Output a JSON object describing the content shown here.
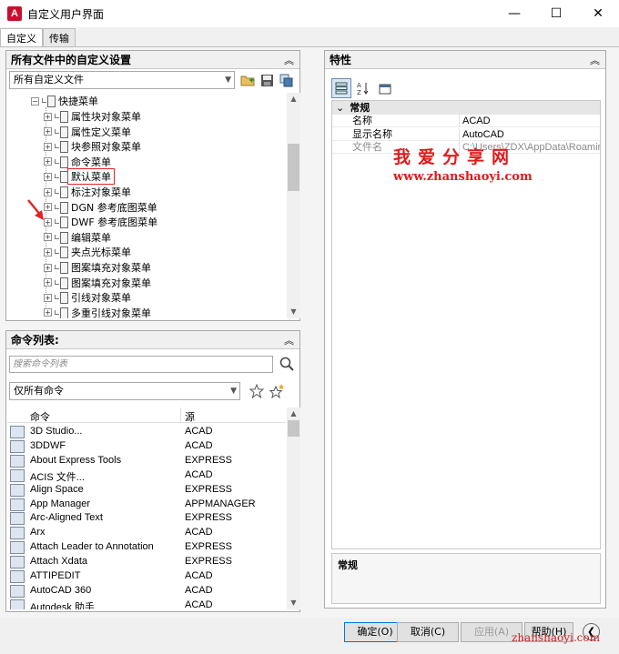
{
  "window": {
    "title": "自定义用户界面",
    "app_icon_letter": "A",
    "minimize": "—",
    "maximize": "☐",
    "close": "✕"
  },
  "tabs": [
    {
      "label": "自定义",
      "active": true
    },
    {
      "label": "传输",
      "active": false
    }
  ],
  "customizations": {
    "header": "所有文件中的自定义设置",
    "file_combo": "所有自定义文件",
    "tree": {
      "parent": "快捷菜单",
      "items": [
        "属性块对象菜单",
        "属性定义菜单",
        "块参照对象菜单",
        "命令菜单",
        "默认菜单",
        "标注对象菜单",
        "DGN 参考底图菜单",
        "DWF 参考底图菜单",
        "编辑菜单",
        "夹点光标菜单",
        "图案填充对象菜单",
        "图案填充对象菜单",
        "引线对象菜单",
        "多重引线对象菜单"
      ],
      "highlighted_index": 4
    }
  },
  "command_list": {
    "header": "命令列表:",
    "search_placeholder": "搜索命令列表",
    "filter_combo": "仅所有命令",
    "columns": {
      "command": "命令",
      "source": "源"
    },
    "rows": [
      {
        "name": "3D Studio...",
        "source": "ACAD"
      },
      {
        "name": "3DDWF",
        "source": "ACAD"
      },
      {
        "name": "About Express Tools",
        "source": "EXPRESS"
      },
      {
        "name": "ACIS 文件...",
        "source": "ACAD"
      },
      {
        "name": "Align Space",
        "source": "EXPRESS"
      },
      {
        "name": "App Manager",
        "source": "APPMANAGER"
      },
      {
        "name": "Arc-Aligned Text",
        "source": "EXPRESS"
      },
      {
        "name": "Arx",
        "source": "ACAD"
      },
      {
        "name": "Attach Leader to Annotation",
        "source": "EXPRESS"
      },
      {
        "name": "Attach Xdata",
        "source": "EXPRESS"
      },
      {
        "name": "ATTIPEDIT",
        "source": "ACAD"
      },
      {
        "name": "AutoCAD 360",
        "source": "ACAD"
      },
      {
        "name": "Autodesk 助手",
        "source": "ACAD"
      }
    ]
  },
  "properties": {
    "header": "特性",
    "category": "常规",
    "rows": [
      {
        "key": "名称",
        "value": "ACAD",
        "dim": false
      },
      {
        "key": "显示名称",
        "value": "AutoCAD",
        "dim": false
      },
      {
        "key": "文件名",
        "value": "C:\\Users\\ZDX\\AppData\\Roaming",
        "dim": true
      }
    ],
    "description_title": "常规"
  },
  "watermark": {
    "cn": "我爱分享网",
    "url": "www.zhanshaoyi.com",
    "bottom": "zhanshaoyi.com"
  },
  "footer": {
    "ok": "确定(O)",
    "cancel": "取消(C)",
    "apply": "应用(A)",
    "help": "帮助(H)"
  }
}
